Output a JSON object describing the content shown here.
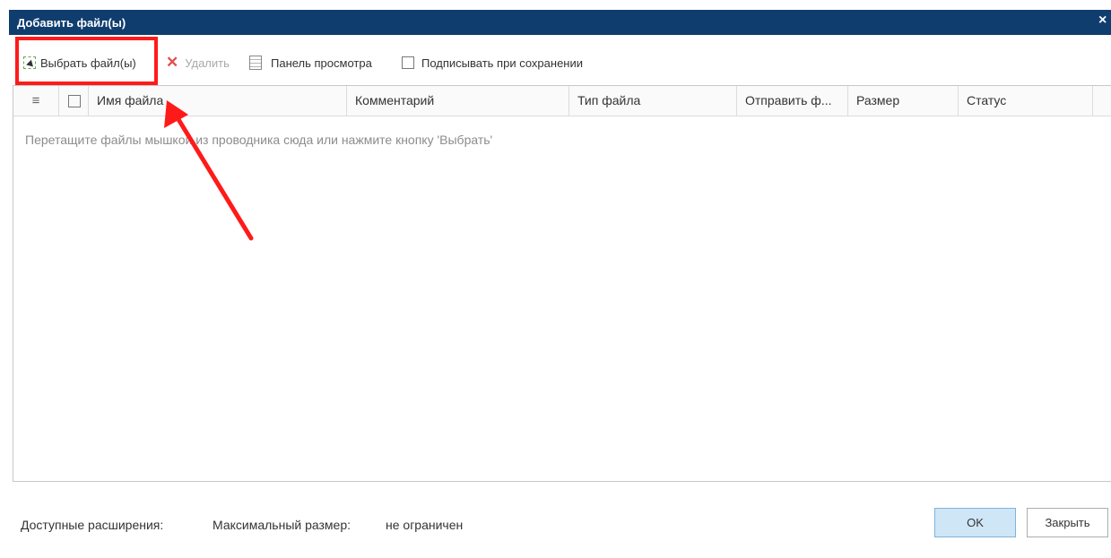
{
  "window": {
    "title": "Добавить файл(ы)",
    "close_icon": "close-icon",
    "close_glyph": "×"
  },
  "toolbar": {
    "select_label": "Выбрать файл(ы)",
    "select_icon": "select-file-icon",
    "delete_label": "Удалить",
    "delete_icon": "delete-x-icon",
    "delete_glyph": "✕",
    "preview_label": "Панель просмотра",
    "preview_icon": "preview-panel-icon",
    "sign_label": "Подписывать при сохранении"
  },
  "grid": {
    "columns": [
      {
        "label": "Имя файла"
      },
      {
        "label": "Комментарий"
      },
      {
        "label": "Тип файла"
      },
      {
        "label": "Отправить ф..."
      },
      {
        "label": "Размер"
      },
      {
        "label": "Статус"
      }
    ],
    "menu_icon": "hamburger-menu-icon",
    "menu_glyph": "≡",
    "empty_text": "Перетащите файлы мышкой из проводника сюда или нажмите кнопку 'Выбрать'"
  },
  "footer": {
    "extensions_label": "Доступные расширения:",
    "max_size_label": "Максимальный размер:",
    "max_size_value": "не ограничен",
    "ok_label": "OK",
    "close_label": "Закрыть"
  },
  "annotation": {
    "highlight_color": "#ff1a1a",
    "arrow_color": "#ff1a1a"
  },
  "colors": {
    "titlebar": "#0f3d6e",
    "ok_button": "#cfe6f7"
  }
}
